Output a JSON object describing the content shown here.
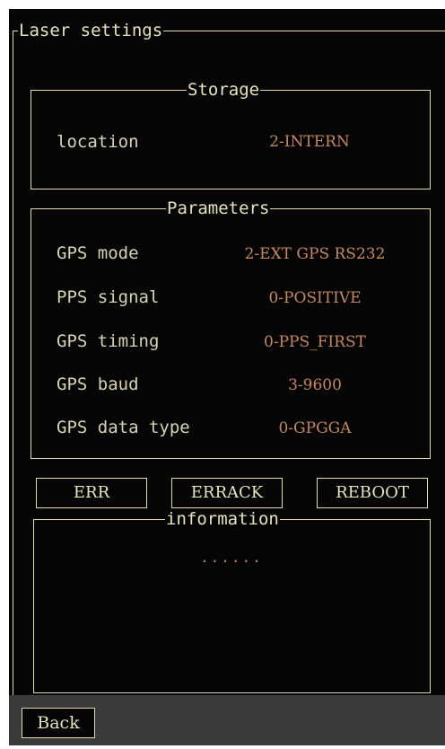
{
  "laser_settings": {
    "title": "Laser settings"
  },
  "storage": {
    "title": "Storage",
    "location_label": "location",
    "location_value": "2-INTERN"
  },
  "parameters": {
    "title": "Parameters",
    "rows": [
      {
        "label": "GPS mode",
        "value": "2-EXT GPS RS232"
      },
      {
        "label": "PPS signal",
        "value": "0-POSITIVE"
      },
      {
        "label": "GPS timing",
        "value": "0-PPS_FIRST"
      },
      {
        "label": "GPS baud",
        "value": "3-9600"
      },
      {
        "label": "GPS data type",
        "value": "0-GPGGA"
      }
    ]
  },
  "buttons": {
    "err": "ERR",
    "errack": "ERRACK",
    "reboot": "REBOOT"
  },
  "information": {
    "title": "information",
    "text": "......"
  },
  "footer": {
    "back_label": "Back"
  },
  "colors": {
    "background": "#050505",
    "border": "#e2dca6",
    "label_text": "#d9d3b0",
    "value_text": "#c8885a",
    "footer_bar": "#3a3a3a"
  }
}
